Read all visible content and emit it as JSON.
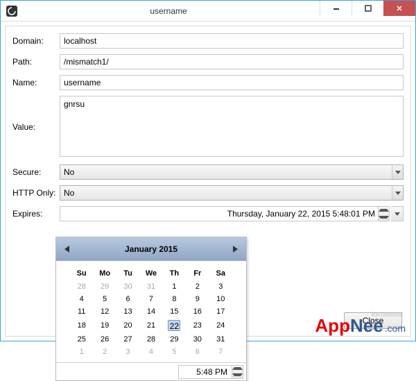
{
  "window": {
    "title": "username",
    "close_label": "Close"
  },
  "form": {
    "domain_label": "Domain:",
    "domain_value": "localhost",
    "path_label": "Path:",
    "path_value": "/mismatch1/",
    "name_label": "Name:",
    "name_value": "username",
    "value_label": "Value:",
    "value_value": "gnrsu",
    "secure_label": "Secure:",
    "secure_value": "No",
    "httponly_label": "HTTP Only:",
    "httponly_value": "No",
    "expires_label": "Expires:",
    "expires_value": "Thursday, January 22, 2015 5:48:01 PM"
  },
  "calendar": {
    "month_title": "January 2015",
    "dow": [
      "Su",
      "Mo",
      "Tu",
      "We",
      "Th",
      "Fr",
      "Sa"
    ],
    "weeks": [
      [
        {
          "d": "28",
          "dim": true
        },
        {
          "d": "29",
          "dim": true
        },
        {
          "d": "30",
          "dim": true
        },
        {
          "d": "31",
          "dim": true
        },
        {
          "d": "1"
        },
        {
          "d": "2"
        },
        {
          "d": "3"
        }
      ],
      [
        {
          "d": "4"
        },
        {
          "d": "5"
        },
        {
          "d": "6"
        },
        {
          "d": "7"
        },
        {
          "d": "8"
        },
        {
          "d": "9"
        },
        {
          "d": "10"
        }
      ],
      [
        {
          "d": "11"
        },
        {
          "d": "12"
        },
        {
          "d": "13"
        },
        {
          "d": "14"
        },
        {
          "d": "15"
        },
        {
          "d": "16"
        },
        {
          "d": "17"
        }
      ],
      [
        {
          "d": "18"
        },
        {
          "d": "19"
        },
        {
          "d": "20"
        },
        {
          "d": "21"
        },
        {
          "d": "22",
          "sel": true
        },
        {
          "d": "23"
        },
        {
          "d": "24"
        }
      ],
      [
        {
          "d": "25"
        },
        {
          "d": "26"
        },
        {
          "d": "27"
        },
        {
          "d": "28"
        },
        {
          "d": "29"
        },
        {
          "d": "30"
        },
        {
          "d": "31"
        }
      ],
      [
        {
          "d": "1",
          "dim": true
        },
        {
          "d": "2",
          "dim": true
        },
        {
          "d": "3",
          "dim": true
        },
        {
          "d": "4",
          "dim": true
        },
        {
          "d": "5",
          "dim": true
        },
        {
          "d": "6",
          "dim": true
        },
        {
          "d": "7",
          "dim": true
        }
      ]
    ],
    "time_value": "5:48 PM"
  },
  "watermark": {
    "part1": "App",
    "part2": "Nee",
    "part3": ".com",
    "rec": "Recommend"
  }
}
